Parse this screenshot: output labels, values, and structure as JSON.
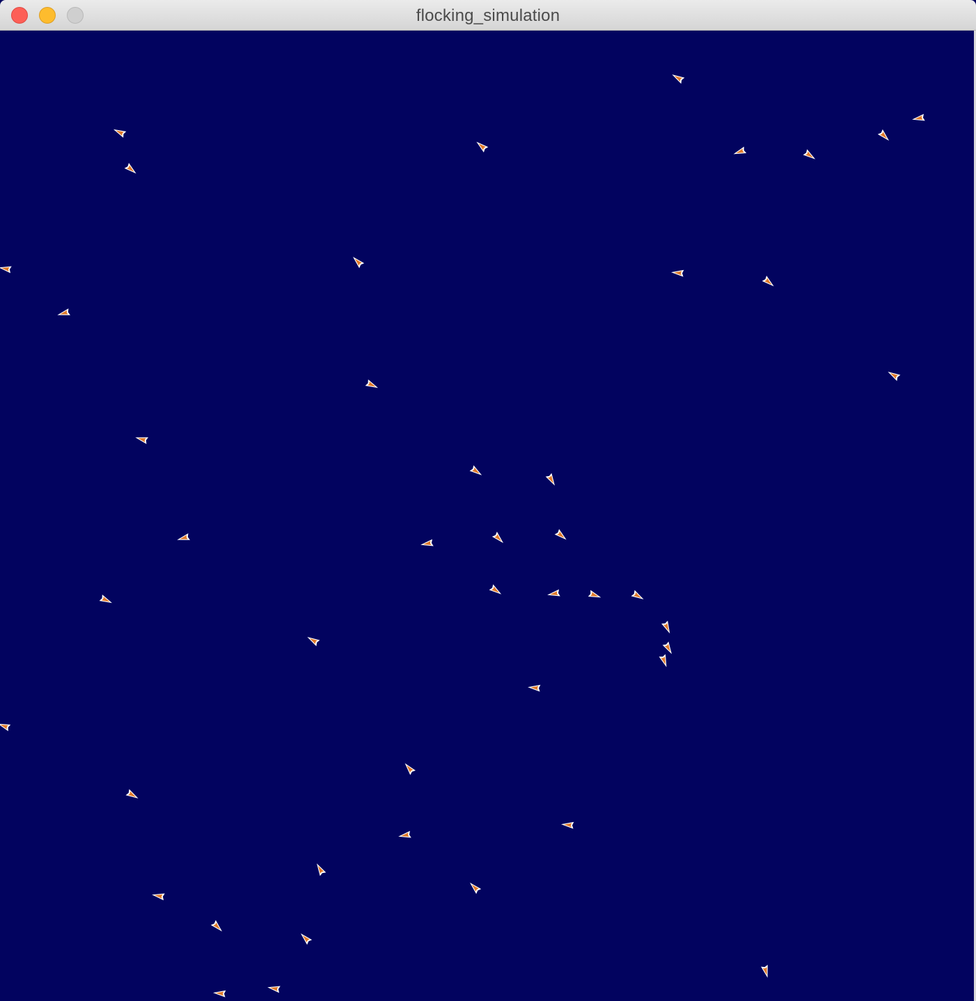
{
  "window": {
    "title": "flocking_simulation",
    "controls": {
      "close": "close-button",
      "minimize": "minimize-button",
      "zoom": "zoom-button"
    }
  },
  "canvas": {
    "background_color": "#02035f",
    "boid_fill_color": "#e07a2a",
    "boid_outline_color": "#ffffff"
  }
}
